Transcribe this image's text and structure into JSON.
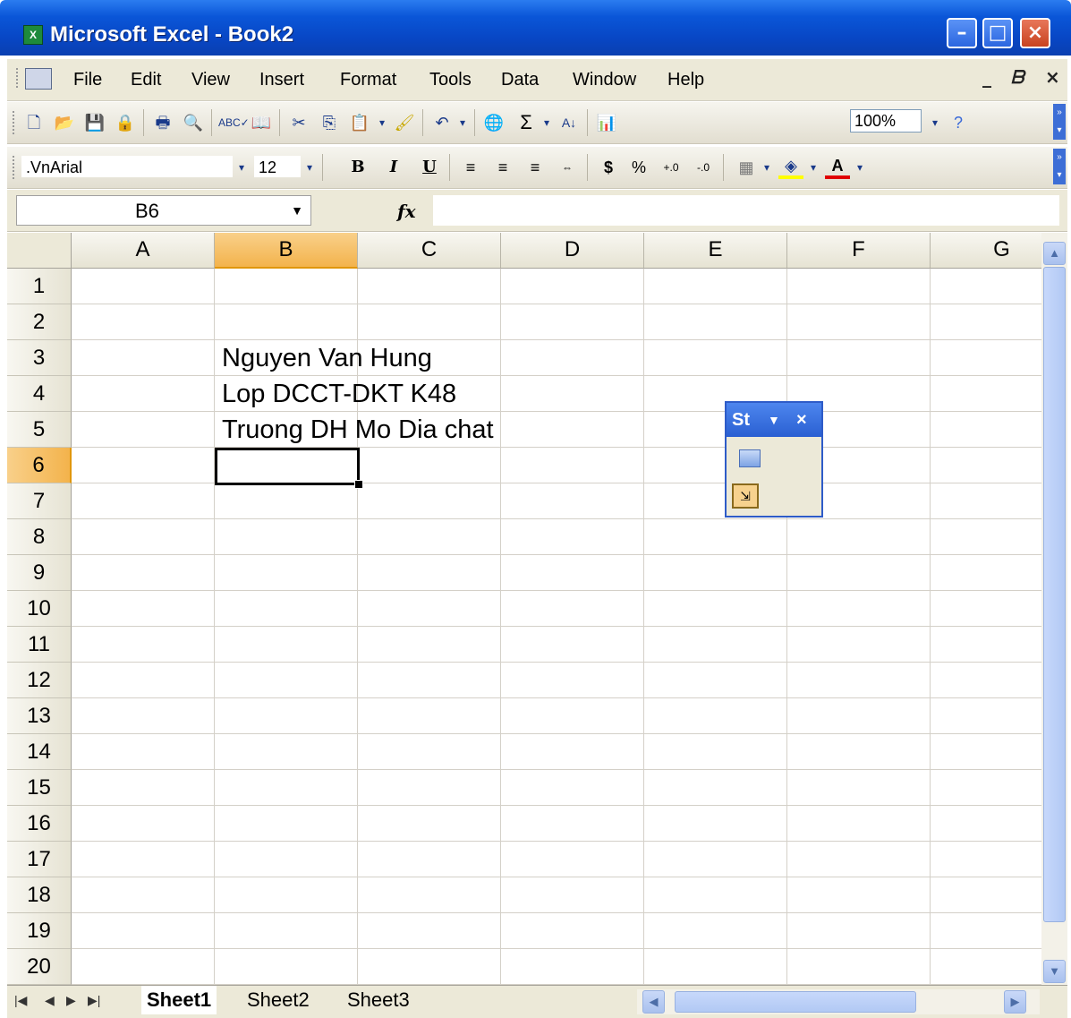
{
  "window": {
    "title": "Microsoft Excel - Book2",
    "app_icon": "excel-icon"
  },
  "menu": {
    "items": [
      "File",
      "Edit",
      "View",
      "Insert",
      "Format",
      "Tools",
      "Data",
      "Window",
      "Help"
    ]
  },
  "standard_toolbar": {
    "zoom": "100%"
  },
  "formatting_toolbar": {
    "font_name": ".VnArial",
    "font_size": "12",
    "bold": "B",
    "italic": "I",
    "underline": "U",
    "currency": "$",
    "percent": "%",
    "font_color_label": "A"
  },
  "formula_bar": {
    "name_box": "B6",
    "fx": "fx",
    "formula": ""
  },
  "sheet": {
    "columns": [
      "A",
      "B",
      "C",
      "D",
      "E",
      "F",
      "G"
    ],
    "rows": [
      "1",
      "2",
      "3",
      "4",
      "5",
      "6",
      "7",
      "8",
      "9",
      "10",
      "11",
      "12",
      "13",
      "14",
      "15",
      "16",
      "17",
      "18",
      "19",
      "20"
    ],
    "active_column": "B",
    "active_row": "6",
    "cells": {
      "B3": "Nguyen Van Hung",
      "B4": "Lop DCCT-DKT K48",
      "B5": "Truong DH Mo Dia chat"
    }
  },
  "floating_toolbar": {
    "title": "St"
  },
  "tabs": [
    "Sheet1",
    "Sheet2",
    "Sheet3"
  ],
  "colors": {
    "title_bar": "#0a56d8",
    "active_header": "#f3b34c",
    "chrome": "#ece9d8"
  }
}
